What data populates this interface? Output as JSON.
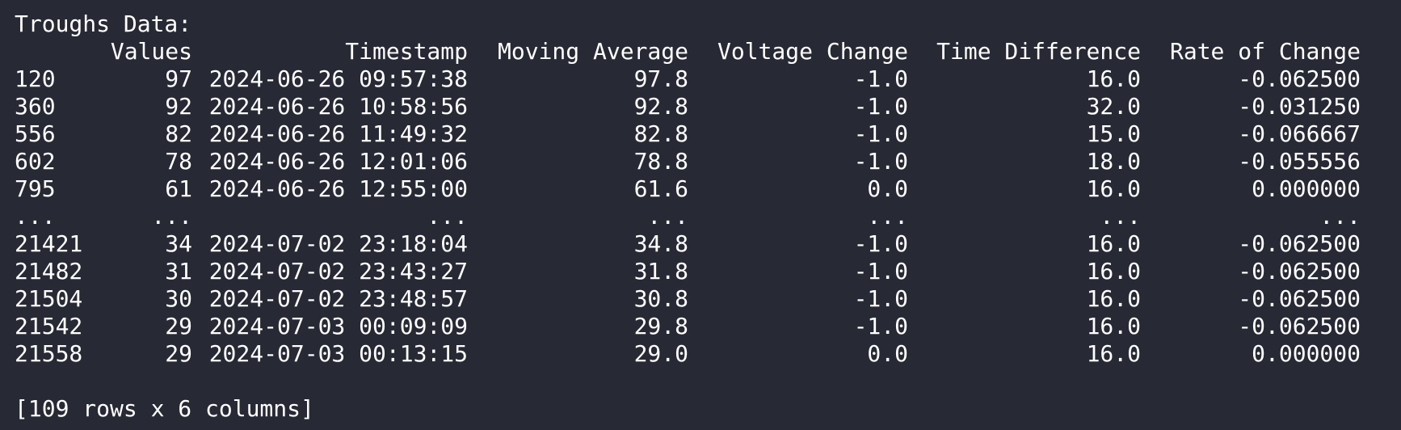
{
  "header": {
    "title": "Troughs Data:"
  },
  "table": {
    "columns": [
      "Values",
      "Timestamp",
      "Moving Average",
      "Voltage Change",
      "Time Difference",
      "Rate of Change"
    ],
    "rows": [
      [
        "120",
        "97",
        "2024-06-26 09:57:38",
        "97.8",
        "-1.0",
        "16.0",
        "-0.062500"
      ],
      [
        "360",
        "92",
        "2024-06-26 10:58:56",
        "92.8",
        "-1.0",
        "32.0",
        "-0.031250"
      ],
      [
        "556",
        "82",
        "2024-06-26 11:49:32",
        "82.8",
        "-1.0",
        "15.0",
        "-0.066667"
      ],
      [
        "602",
        "78",
        "2024-06-26 12:01:06",
        "78.8",
        "-1.0",
        "18.0",
        "-0.055556"
      ],
      [
        "795",
        "61",
        "2024-06-26 12:55:00",
        "61.6",
        "0.0",
        "16.0",
        "0.000000"
      ],
      [
        "...",
        "...",
        "...",
        "...",
        "...",
        "...",
        "..."
      ],
      [
        "21421",
        "34",
        "2024-07-02 23:18:04",
        "34.8",
        "-1.0",
        "16.0",
        "-0.062500"
      ],
      [
        "21482",
        "31",
        "2024-07-02 23:43:27",
        "31.8",
        "-1.0",
        "16.0",
        "-0.062500"
      ],
      [
        "21504",
        "30",
        "2024-07-02 23:48:57",
        "30.8",
        "-1.0",
        "16.0",
        "-0.062500"
      ],
      [
        "21542",
        "29",
        "2024-07-03 00:09:09",
        "29.8",
        "-1.0",
        "16.0",
        "-0.062500"
      ],
      [
        "21558",
        "29",
        "2024-07-03 00:13:15",
        "29.0",
        "0.0",
        "16.0",
        "0.000000"
      ]
    ]
  },
  "footer": {
    "summary": "[109 rows x 6 columns]"
  }
}
